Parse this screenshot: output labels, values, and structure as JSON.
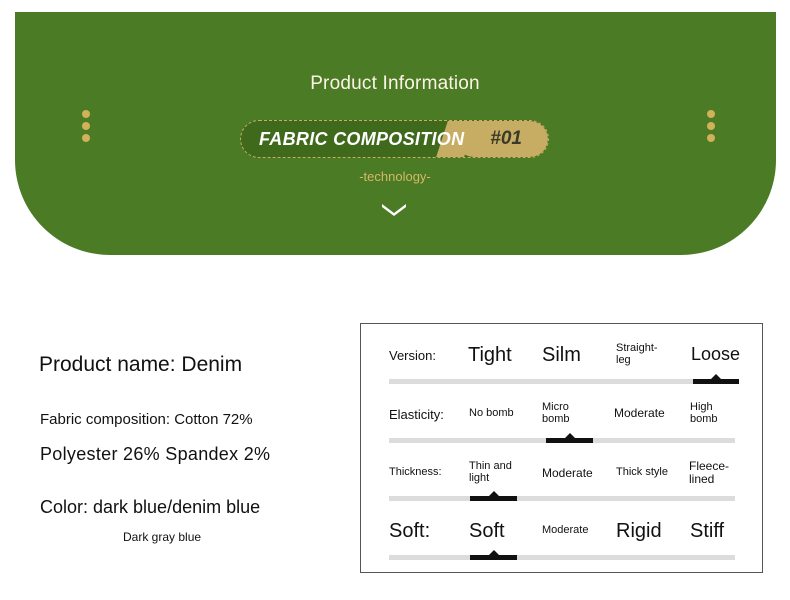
{
  "header": {
    "title": "Product Information",
    "pill_label": "FABRIC COMPOSITION",
    "pill_number": "#01",
    "subtitle": "-technology-",
    "chevron_icon": "chevron-down-icon",
    "dots_icon": "vertical-dots-icon"
  },
  "product": {
    "name": "Product name: Denim",
    "composition_line1": "Fabric composition: Cotton 72%",
    "composition_line2": "Polyester 26% Spandex 2%",
    "color": "Color: dark blue/denim blue",
    "swatch_label": "Dark gray blue"
  },
  "attributes": [
    {
      "label": "Version:",
      "options": [
        "Tight",
        "Silm",
        "Straight-leg",
        "Loose"
      ],
      "selected": "Loose"
    },
    {
      "label": "Elasticity:",
      "options": [
        "No bomb",
        "Micro bomb",
        "Moderate",
        "High bomb"
      ],
      "selected": "Micro bomb"
    },
    {
      "label": "Thickness:",
      "options": [
        "Thin and light",
        "Moderate",
        "Thick style",
        "Fleece-lined"
      ],
      "selected": "Thin and light"
    },
    {
      "label": "Soft:",
      "options": [
        "Soft",
        "Moderate",
        "Rigid",
        "Stiff"
      ],
      "selected": "Soft"
    }
  ],
  "colors": {
    "banner_green": "#4c7b25",
    "gold": "#c7ad63",
    "selection_black": "#111111",
    "track_gray": "#dcdcdc"
  }
}
